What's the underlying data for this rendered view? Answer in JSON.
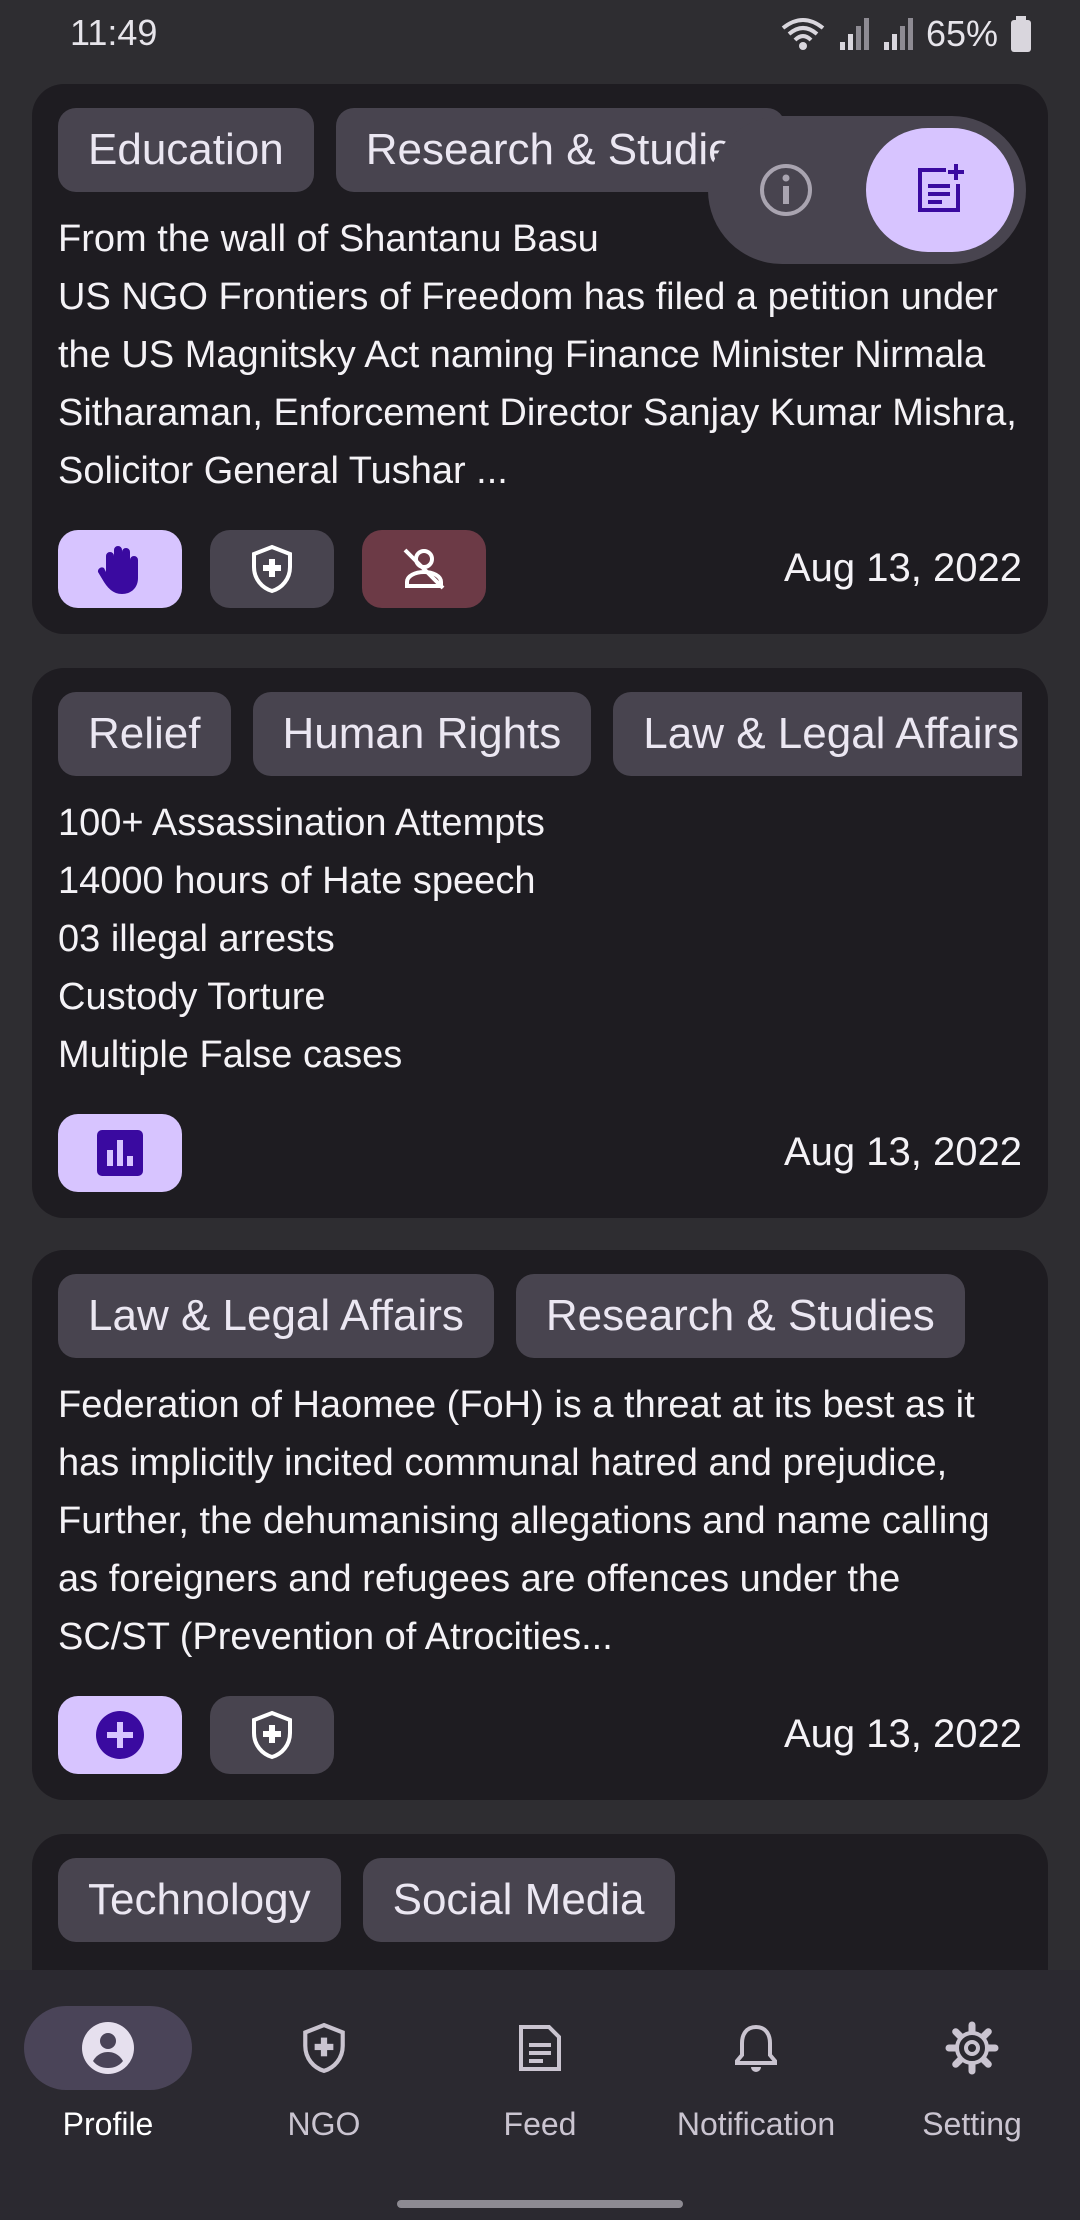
{
  "status_bar": {
    "time": "11:49",
    "battery": "65%",
    "icons": [
      "wifi-icon",
      "signal-icon",
      "signal-icon",
      "battery-icon"
    ]
  },
  "colors": {
    "background": "#2e2d31",
    "card": "#1e1c21",
    "chip": "#48444f",
    "primary": "#d7c4ff",
    "on_primary": "#3a0aa0",
    "danger": "#6c3a46"
  },
  "feed": {
    "cards": [
      {
        "chips": [
          "Education",
          "Research & Studies"
        ],
        "text": "From the wall of Shantanu Basu\nUS NGO Frontiers of Freedom has filed a petition under the US Magnitsky Act naming Finance Minister Nirmala Sitharaman, Enforcement Director Sanjay Kumar Mishra, Solicitor General Tushar ...",
        "actions": [
          "hand-icon",
          "ngo-shield-icon",
          "person-off-icon"
        ],
        "date": "Aug 13, 2022"
      },
      {
        "chips": [
          "Relief",
          "Human Rights",
          "Law & Legal Affairs"
        ],
        "text": "100+ Assassination Attempts\n14000 hours of Hate speech\n03 illegal arrests\nCustody Torture\nMultiple False cases",
        "actions": [
          "poll-icon"
        ],
        "date": "Aug 13, 2022"
      },
      {
        "chips": [
          "Law & Legal Affairs",
          "Research & Studies"
        ],
        "text": "Federation of Haomee (FoH) is a threat at its best as it has implicitly  incited communal hatred and prejudice,  Further, the dehumanising allegations and name calling as foreigners and refugees are offences under the SC/ST (Prevention of Atrocities...",
        "actions": [
          "add-circle-icon",
          "ngo-shield-icon"
        ],
        "date": "Aug 13, 2022"
      },
      {
        "chips": [
          "Technology",
          "Social Media"
        ]
      }
    ]
  },
  "fab": {
    "info_icon": "info-icon",
    "main_icon": "post-add-icon"
  },
  "bottom_nav": {
    "items": [
      {
        "label": "Profile",
        "icon": "profile-icon",
        "active": true
      },
      {
        "label": "NGO",
        "icon": "ngo-shield-icon",
        "active": false
      },
      {
        "label": "Feed",
        "icon": "feed-icon",
        "active": false
      },
      {
        "label": "Notification",
        "icon": "bell-icon",
        "active": false
      },
      {
        "label": "Setting",
        "icon": "gear-icon",
        "active": false
      }
    ]
  }
}
